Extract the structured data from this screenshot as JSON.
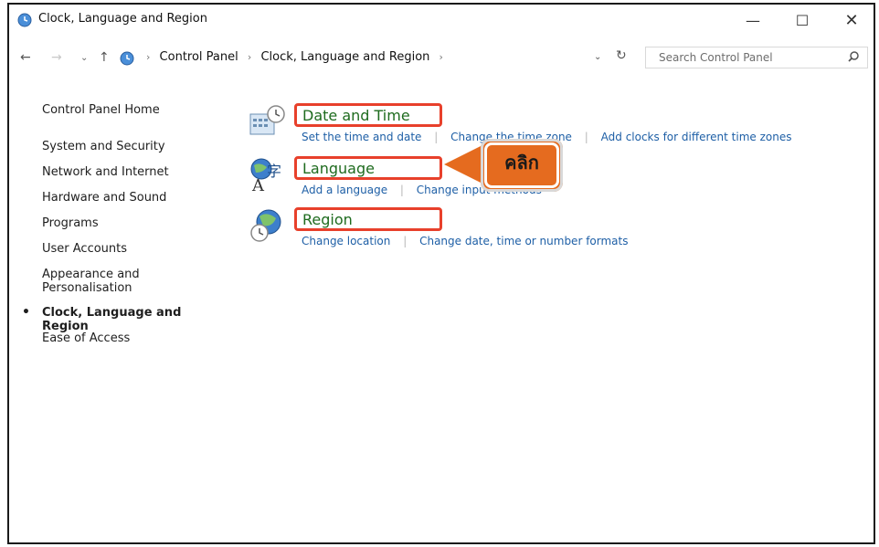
{
  "window": {
    "title": "Clock, Language and Region",
    "controls": {
      "minimize": "—",
      "maximize": "☐",
      "close": "✕"
    }
  },
  "nav": {
    "back": "←",
    "forward": "→",
    "dropdown": "⌄",
    "up": "↑",
    "breadcrumb": [
      "Control Panel",
      "Clock, Language and Region"
    ],
    "breadcrumb_trailing_sep": "›",
    "address_dropdown": "⌄",
    "refresh": "↻",
    "search_placeholder": "Search Control Panel"
  },
  "sidebar": {
    "items": [
      {
        "label": "Control Panel Home"
      },
      {
        "label": "System and Security"
      },
      {
        "label": "Network and Internet"
      },
      {
        "label": "Hardware and Sound"
      },
      {
        "label": "Programs"
      },
      {
        "label": "User Accounts"
      },
      {
        "label": "Appearance and Personalisation"
      },
      {
        "label": "Clock, Language and Region",
        "active": true
      },
      {
        "label": "Ease of Access"
      }
    ]
  },
  "categories": [
    {
      "title": "Date and Time",
      "links": [
        "Set the time and date",
        "Change the time zone",
        "Add clocks for different time zones"
      ]
    },
    {
      "title": "Language",
      "links": [
        "Add a language",
        "Change input methods"
      ]
    },
    {
      "title": "Region",
      "links": [
        "Change location",
        "Change date, time or number formats"
      ]
    }
  ],
  "callout": {
    "text": "คลิก"
  },
  "colors": {
    "highlight_border": "#e8402b",
    "callout_fill": "#e56b1f",
    "link": "#1e5fa6",
    "category_title": "#1e6b1e"
  },
  "icons": {
    "title": "clock-globe-icon",
    "date_time": "calendar-clock-icon",
    "language": "language-icon",
    "region": "globe-clock-icon",
    "search": "search-icon"
  }
}
